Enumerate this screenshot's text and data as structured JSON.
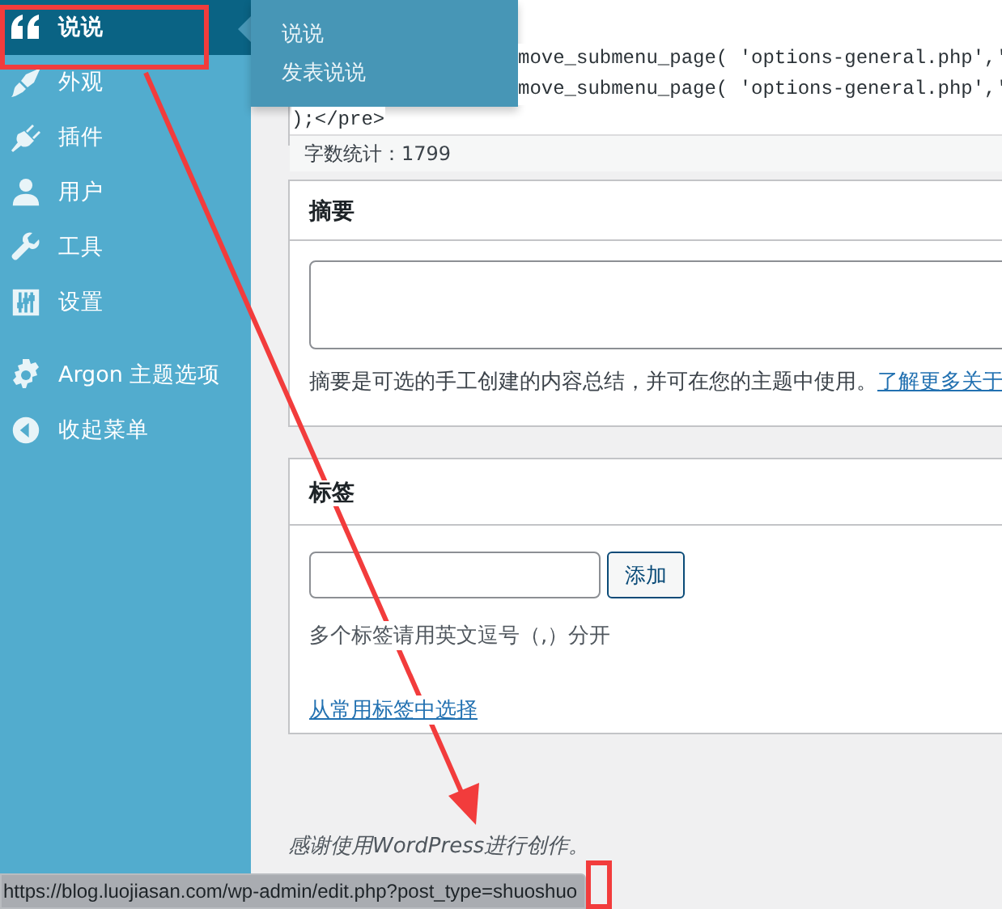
{
  "sidebar": {
    "items": [
      {
        "label": "说说",
        "selected": true
      },
      {
        "label": "外观",
        "selected": false
      },
      {
        "label": "插件",
        "selected": false
      },
      {
        "label": "用户",
        "selected": false
      },
      {
        "label": "工具",
        "selected": false
      },
      {
        "label": "设置",
        "selected": false
      },
      {
        "label": "Argon 主题选项",
        "selected": false
      },
      {
        "label": "收起菜单",
        "selected": false
      }
    ]
  },
  "flyout": {
    "items": [
      "说说",
      "发表说说"
    ]
  },
  "editor": {
    "code_lines": [
      "move_submenu_page( 'options-general.php','",
      "move_submenu_page( 'options-general.php','",
      ");</pre>"
    ],
    "word_count": "字数统计：1799"
  },
  "excerpt": {
    "title": "摘要",
    "help": "摘要是可选的手工创建的内容总结，并可在您的主题中使用。",
    "link": "了解更多关于"
  },
  "tags": {
    "title": "标签",
    "add_button": "添加",
    "help": "多个标签请用英文逗号（,）分开",
    "link": "从常用标签中选择"
  },
  "footer": "感谢使用WordPress进行创作。",
  "status_bar": {
    "url": "https://blog.luojiasan.com/wp-admin/edit.php?post_type=shuoshuo"
  }
}
